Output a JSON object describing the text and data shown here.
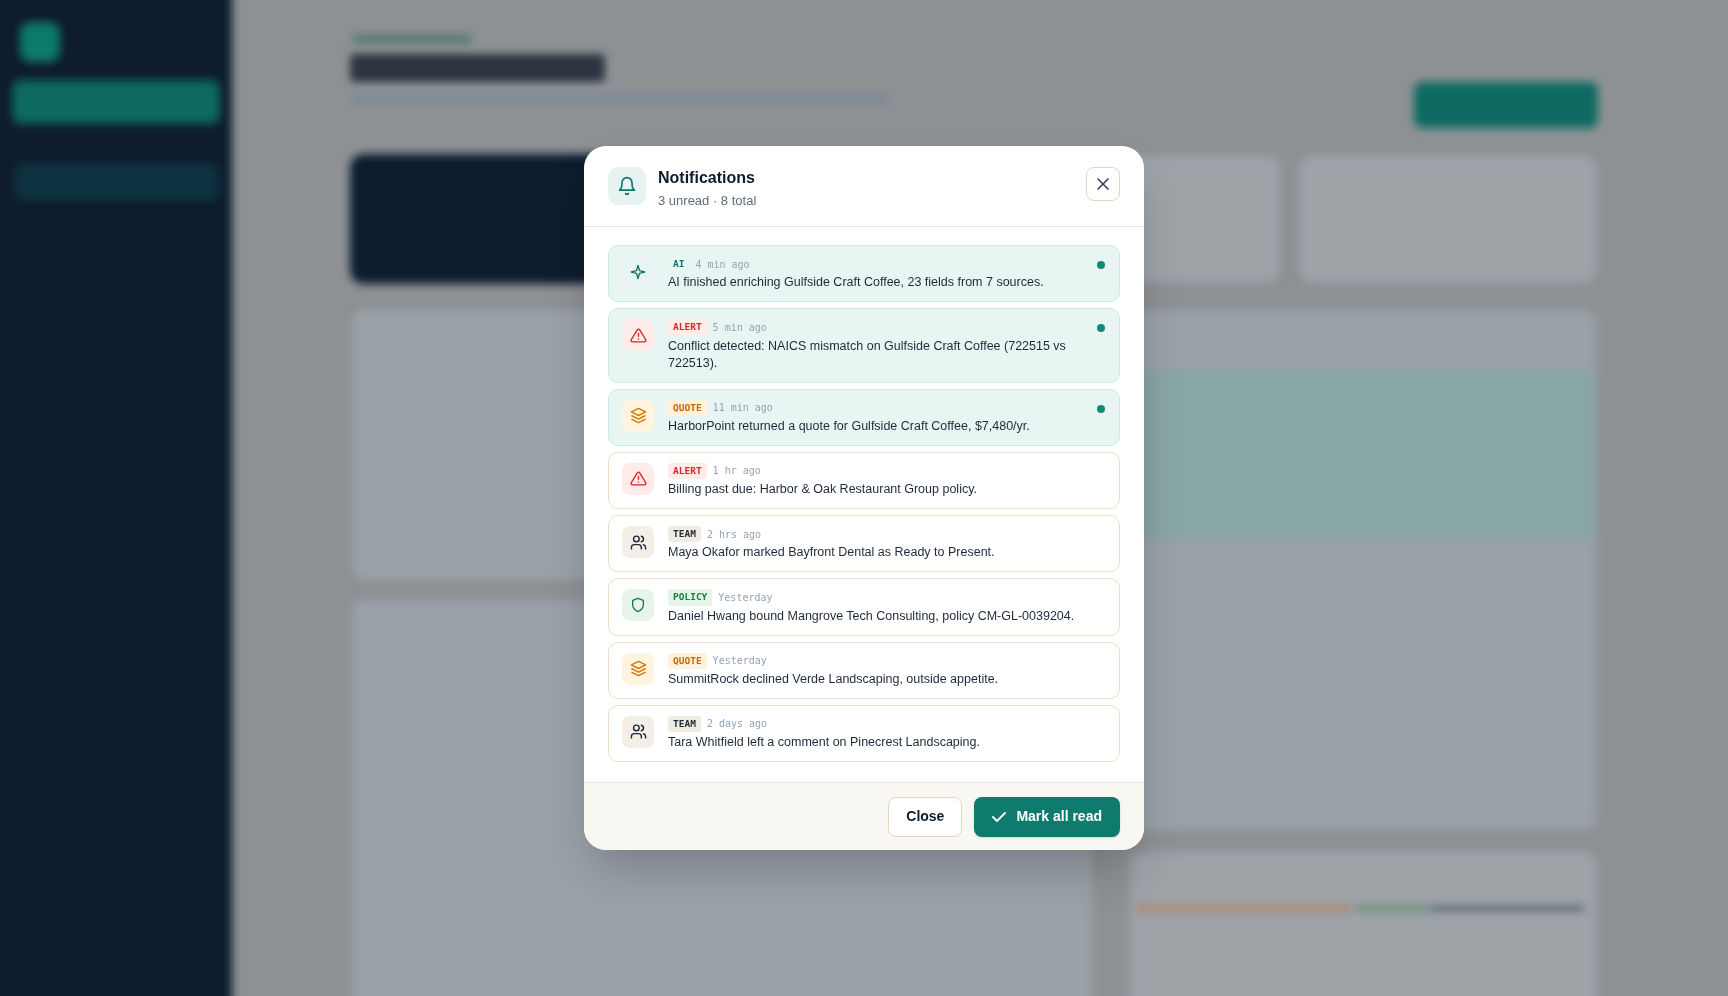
{
  "dialog": {
    "title": "Notifications",
    "subtitle": "3 unread · 8 total"
  },
  "notifications": [
    {
      "kind": "ai",
      "tag": "AI",
      "time": "4 min ago",
      "text": "AI finished enriching Gulfside Craft Coffee, 23 fields from 7 sources.",
      "unread": true
    },
    {
      "kind": "alert",
      "tag": "ALERT",
      "time": "5 min ago",
      "text": "Conflict detected: NAICS mismatch on Gulfside Craft Coffee (722515 vs 722513).",
      "unread": true
    },
    {
      "kind": "quote",
      "tag": "QUOTE",
      "time": "11 min ago",
      "text": "HarborPoint returned a quote for Gulfside Craft Coffee, $7,480/yr.",
      "unread": true
    },
    {
      "kind": "alert",
      "tag": "ALERT",
      "time": "1 hr ago",
      "text": "Billing past due: Harbor & Oak Restaurant Group policy.",
      "unread": false
    },
    {
      "kind": "team",
      "tag": "TEAM",
      "time": "2 hrs ago",
      "text": "Maya Okafor marked Bayfront Dental as Ready to Present.",
      "unread": false
    },
    {
      "kind": "policy",
      "tag": "POLICY",
      "time": "Yesterday",
      "text": "Daniel Hwang bound Mangrove Tech Consulting, policy CM-GL-0039204.",
      "unread": false
    },
    {
      "kind": "quote",
      "tag": "QUOTE",
      "time": "Yesterday",
      "text": "SummitRock declined Verde Landscaping, outside appetite.",
      "unread": false
    },
    {
      "kind": "team",
      "tag": "TEAM",
      "time": "2 days ago",
      "text": "Tara Whitfield left a comment on Pinecrest Landscaping.",
      "unread": false
    }
  ],
  "buttons": {
    "close": "Close",
    "mark_all_read": "Mark all read"
  }
}
